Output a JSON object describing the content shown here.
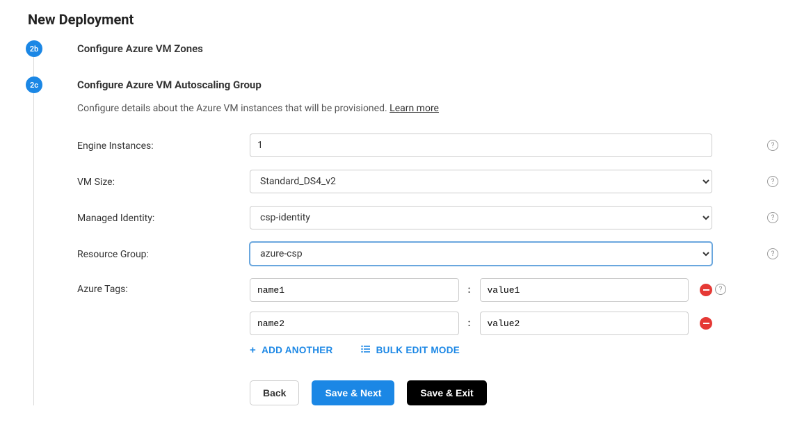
{
  "page": {
    "title": "New Deployment"
  },
  "steps": {
    "b": {
      "badge": "2b",
      "title": "Configure Azure VM Zones"
    },
    "c": {
      "badge": "2c",
      "title": "Configure Azure VM Autoscaling Group",
      "desc": "Configure details about the Azure VM instances that will be provisioned.",
      "learn_more": "Learn more"
    }
  },
  "form": {
    "engine_instances": {
      "label": "Engine Instances:",
      "value": "1"
    },
    "vm_size": {
      "label": "VM Size:",
      "value": "Standard_DS4_v2"
    },
    "managed_identity": {
      "label": "Managed Identity:",
      "value": "csp-identity"
    },
    "resource_group": {
      "label": "Resource Group:",
      "value": "azure-csp"
    },
    "azure_tags": {
      "label": "Azure Tags:",
      "rows": [
        {
          "name": "name1",
          "value": "value1"
        },
        {
          "name": "name2",
          "value": "value2"
        }
      ],
      "separator": ":"
    }
  },
  "actions": {
    "add_another": "ADD ANOTHER",
    "bulk_edit": "BULK EDIT MODE",
    "back": "Back",
    "save_next": "Save & Next",
    "save_exit": "Save & Exit"
  },
  "glyphs": {
    "help": "?",
    "plus": "+",
    "list": "⠿"
  }
}
